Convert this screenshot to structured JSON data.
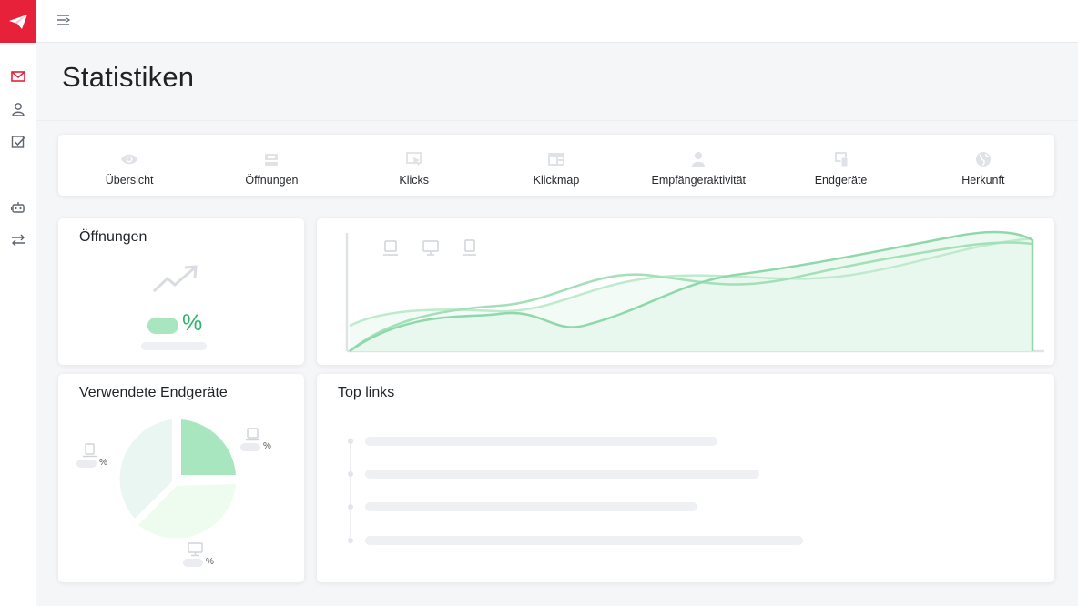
{
  "app": {
    "accent_color": "#e8213a",
    "logo_icon": "paper-plane-icon"
  },
  "sidebar": {
    "items": [
      {
        "icon": "mail-icon",
        "active": true
      },
      {
        "icon": "user-icon",
        "active": false
      },
      {
        "icon": "checkbox-icon",
        "active": false
      },
      {
        "icon": "robot-icon",
        "active": false
      },
      {
        "icon": "swap-arrows-icon",
        "active": false
      }
    ]
  },
  "topbar": {
    "menu_icon": "menu-toggle-icon"
  },
  "page": {
    "title": "Statistiken"
  },
  "tabs": [
    {
      "label": "Übersicht",
      "icon": "eye-icon"
    },
    {
      "label": "Öffnungen",
      "icon": "inbox-icon"
    },
    {
      "label": "Klicks",
      "icon": "cursor-click-icon"
    },
    {
      "label": "Klickmap",
      "icon": "heatmap-icon"
    },
    {
      "label": "Empfängeraktivität",
      "icon": "person-icon"
    },
    {
      "label": "Endgeräte",
      "icon": "devices-icon"
    },
    {
      "label": "Herkunft",
      "icon": "globe-icon"
    }
  ],
  "openings_card": {
    "title": "Öffnungen",
    "percent_symbol": "%",
    "trend_icon": "trend-up-icon",
    "status_color": "#2db36a"
  },
  "timeline_card": {
    "device_icons": [
      "tablet-icon",
      "desktop-icon",
      "phone-icon"
    ]
  },
  "devices_card": {
    "title": "Verwendete Endgeräte",
    "labels": [
      {
        "icon": "tablet-icon",
        "percent_symbol": "%"
      },
      {
        "icon": "phone-icon",
        "percent_symbol": "%"
      },
      {
        "icon": "desktop-icon",
        "percent_symbol": "%"
      }
    ]
  },
  "links_card": {
    "title": "Top links",
    "item_count": 4
  }
}
